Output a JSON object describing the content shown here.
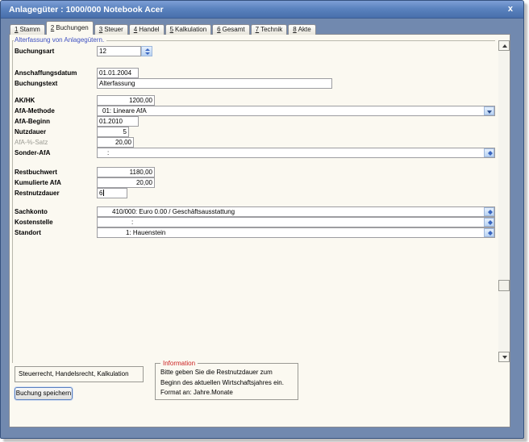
{
  "window": {
    "title": "Anlagegüter : 1000/000 Notebook Acer",
    "close_label": "x"
  },
  "colors": {
    "titlebar_blue": "#5b83bf",
    "frame_blue": "#7189af",
    "panel_bg": "#fbf9f1",
    "section_label_blue": "#3f51c1",
    "info_title_red": "#cc2222",
    "spinner_accent_blue": "#3a66c0"
  },
  "icons": {
    "close": "x-glyph",
    "combo_dropdown": "down-arrow",
    "spinner": "up-down-arrows",
    "scroll_up": "up-arrow",
    "scroll_down": "down-arrow"
  },
  "tabs": [
    {
      "num": "1",
      "label": "Stamm",
      "active": false
    },
    {
      "num": "2",
      "label": "Buchungen",
      "active": true
    },
    {
      "num": "3",
      "label": "Steuer",
      "active": false
    },
    {
      "num": "4",
      "label": "Handel",
      "active": false
    },
    {
      "num": "5",
      "label": "Kalkulation",
      "active": false
    },
    {
      "num": "6",
      "label": "Gesamt",
      "active": false
    },
    {
      "num": "7",
      "label": "Technik",
      "active": false
    },
    {
      "num": "8",
      "label": "Akte",
      "active": false
    }
  ],
  "form": {
    "section_title": "Alterfassung von Anlagegütern.",
    "fields": {
      "buchungsart": {
        "label": "Buchungsart",
        "value": "12"
      },
      "anschaffungsdatum": {
        "label": "Anschaffungsdatum",
        "value": "01.01.2004"
      },
      "buchungstext": {
        "label": "Buchungstext",
        "value": "Alterfassung"
      },
      "akhk": {
        "label": "AK/HK",
        "value": "1200,00"
      },
      "afa_methode": {
        "label": "AfA-Methode",
        "value": "01: Lineare AfA"
      },
      "afa_beginn": {
        "label": "AfA-Beginn",
        "value": "01.2010"
      },
      "nutzdauer": {
        "label": "Nutzdauer",
        "value": "5"
      },
      "afa_satz": {
        "label": "AfA-%-Satz",
        "value": "20,00"
      },
      "sonder_afa": {
        "label": "Sonder-AfA",
        "value": ":"
      },
      "restbuchwert": {
        "label": "Restbuchwert",
        "value": "1180,00"
      },
      "kumulierte_afa": {
        "label": "Kumulierte AfA",
        "value": "20,00"
      },
      "restnutzdauer": {
        "label": "Restnutzdauer",
        "value": "6"
      },
      "sachkonto": {
        "label": "Sachkonto",
        "value": "410/000: Euro 0.00 / Geschäftsausstattung"
      },
      "kostenstelle": {
        "label": "Kostenstelle",
        "value": ":"
      },
      "standort": {
        "label": "Standort",
        "value": "1: Hauenstein"
      }
    }
  },
  "footer": {
    "summary": "Steuerrecht, Handelsrecht, Kalkulation",
    "save_button": "Buchung speichern",
    "info": {
      "title": "Information",
      "lines": [
        "Bitte geben Sie die Restnutzdauer zum",
        "Beginn des aktuellen Wirtschaftsjahres ein.",
        "Format an: Jahre.Monate"
      ]
    }
  }
}
